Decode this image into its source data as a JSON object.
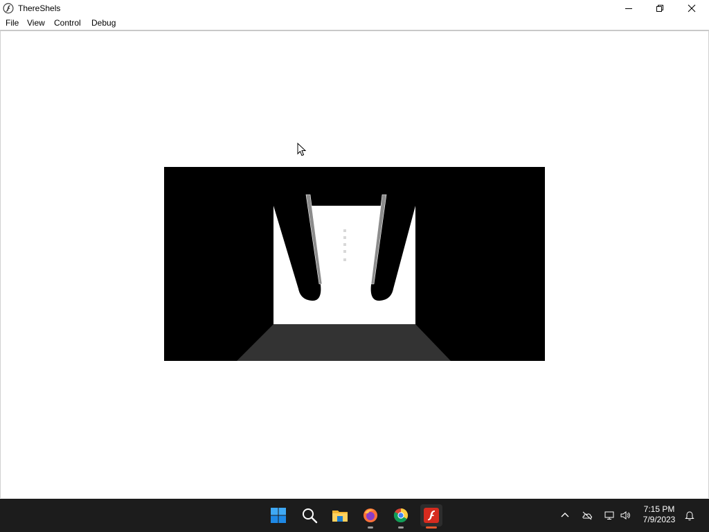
{
  "window": {
    "title": "ThereShels",
    "icon": "flash-player-icon",
    "controls": [
      "minimize-icon",
      "restore-icon",
      "close-icon"
    ]
  },
  "menubar": {
    "items": [
      "File",
      "View",
      "Control",
      "Debug"
    ]
  },
  "stage": {
    "background": "#000000",
    "scene": "corridor-view",
    "colors": {
      "doorway": "#ffffff",
      "floor": "#333333",
      "hands": "#000000",
      "blades": "#8c8c8c"
    }
  },
  "taskbar": {
    "background": "#1c1c1c",
    "pinned": [
      "windows-start-icon",
      "search-icon",
      "file-explorer-icon",
      "firefox-icon",
      "chrome-icon",
      "flash-player-icon"
    ],
    "active_app": "flash-player-icon",
    "tray_icons": [
      "chevron-up-icon",
      "onedrive-icon",
      "network-icon",
      "speaker-icon",
      "notification-icon"
    ],
    "clock": {
      "time": "7:15 PM",
      "date": "7/9/2023"
    },
    "accent_color": "#e4572e"
  }
}
